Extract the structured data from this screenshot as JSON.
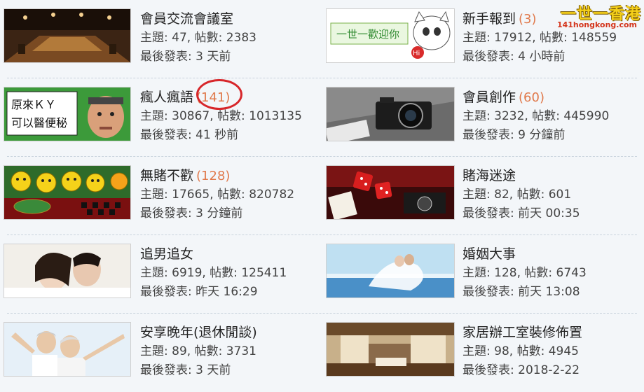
{
  "watermark": {
    "title": "一世一香港",
    "url": "141hongkong.com"
  },
  "labels": {
    "topics": "主題: ",
    "posts": ", 帖數: ",
    "last": "最後發表: "
  },
  "forums": [
    {
      "name": "會員交流會議室",
      "today": "",
      "topics": "47",
      "posts": "2383",
      "last": "3 天前",
      "icon": "meeting-room-image"
    },
    {
      "name": "新手報到",
      "today": "(3)",
      "topics": "17912",
      "posts": "148559",
      "last": "4 小時前",
      "icon": "welcome-hi-image"
    },
    {
      "name": "瘋人瘋語",
      "today": "(141)",
      "topics": "30867",
      "posts": "1013135",
      "last": "41 秒前",
      "icon": "ky-man-image",
      "thumb_text": "原來ＫＹ\n可以醫便秘"
    },
    {
      "name": "會員創作",
      "today": "(60)",
      "topics": "3232",
      "posts": "445990",
      "last": "9 分鐘前",
      "icon": "camera-image"
    },
    {
      "name": "無賭不歡",
      "today": "(128)",
      "topics": "17665",
      "posts": "820782",
      "last": "3 分鐘前",
      "icon": "casino-smileys-image"
    },
    {
      "name": "賭海迷途",
      "today": "",
      "topics": "82",
      "posts": "601",
      "last": "前天 00:35",
      "icon": "dice-cards-image"
    },
    {
      "name": "追男追女",
      "today": "",
      "topics": "6919",
      "posts": "125411",
      "last": "昨天 16:29",
      "icon": "couple-image"
    },
    {
      "name": "婚姻大事",
      "today": "",
      "topics": "128",
      "posts": "6743",
      "last": "前天 13:08",
      "icon": "wedding-image"
    },
    {
      "name": "安享晚年(退休閒談)",
      "today": "",
      "topics": "89",
      "posts": "3731",
      "last": "3 天前",
      "icon": "elderly-couple-image"
    },
    {
      "name": "家居辦工室裝修佈置",
      "today": "",
      "topics": "98",
      "posts": "4945",
      "last": "2018-2-22",
      "icon": "interior-room-image"
    }
  ],
  "colors": {
    "today_count": "#e0794b",
    "highlight_circle": "#d7262a",
    "background": "#f3f6f9"
  }
}
